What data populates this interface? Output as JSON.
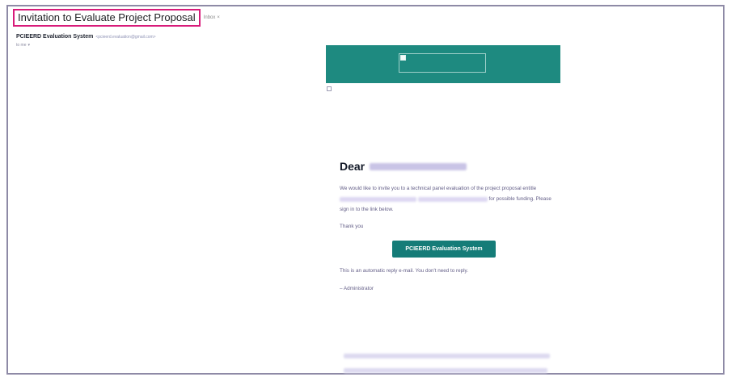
{
  "email": {
    "subject": "Invitation to Evaluate Project Proposal",
    "label": "Inbox",
    "label_remove": "×",
    "sender_name": "PCIEERD Evaluation System",
    "sender_email": "<pcieerd.evaluation@gmail.com>",
    "recipient": "to me",
    "recipient_caret": "▾"
  },
  "body": {
    "greeting": "Dear",
    "para_start": "We would like to invite you to a technical panel evaluation of the project proposal entitle",
    "para_end": "for possible funding. Please sign in to the link below.",
    "thank_you": "Thank you",
    "cta_label": "PCIEERD Evaluation System",
    "auto_note": "This is an automatic reply e-mail. You don't need to reply.",
    "signoff": "– Administrator"
  },
  "colors": {
    "banner": "#1e8a80",
    "button": "#157c78",
    "subject_highlight": "#d81b7a"
  }
}
